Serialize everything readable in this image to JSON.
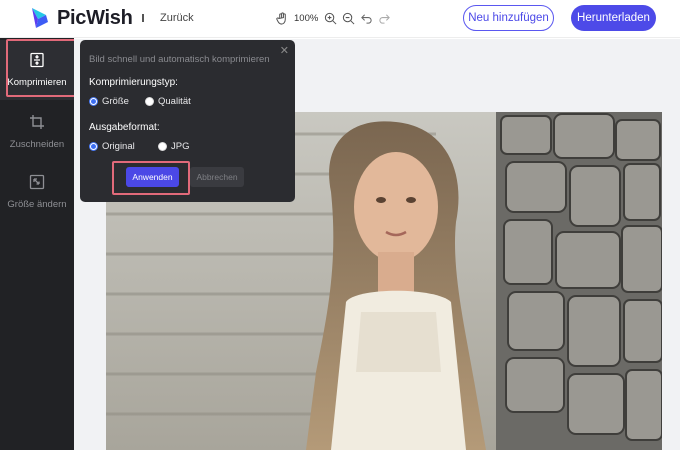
{
  "header": {
    "brand": "PicWish",
    "back_label": "Zurück",
    "zoom": "100%",
    "new_button": "Neu hinzufügen",
    "download_button": "Herunterladen"
  },
  "sidebar": {
    "items": [
      {
        "label": "Komprimieren",
        "icon": "compress-icon",
        "active": true
      },
      {
        "label": "Zuschneiden",
        "icon": "crop-icon",
        "active": false
      },
      {
        "label": "Größe ändern",
        "icon": "resize-icon",
        "active": false
      }
    ]
  },
  "popup": {
    "description": "Bild schnell und automatisch komprimieren",
    "compression_type_label": "Komprimierungstyp:",
    "compression_options": [
      {
        "label": "Größe",
        "checked": true
      },
      {
        "label": "Qualität",
        "checked": false
      }
    ],
    "output_format_label": "Ausgabeformat:",
    "format_options": [
      {
        "label": "Original",
        "checked": true
      },
      {
        "label": "JPG",
        "checked": false
      }
    ],
    "apply_button": "Anwenden",
    "cancel_button": "Abbrechen"
  },
  "colors": {
    "accent": "#4d4ae8",
    "sidebar_bg": "#212225",
    "popup_bg": "#2b2c30",
    "highlight": "#e16a7a"
  }
}
